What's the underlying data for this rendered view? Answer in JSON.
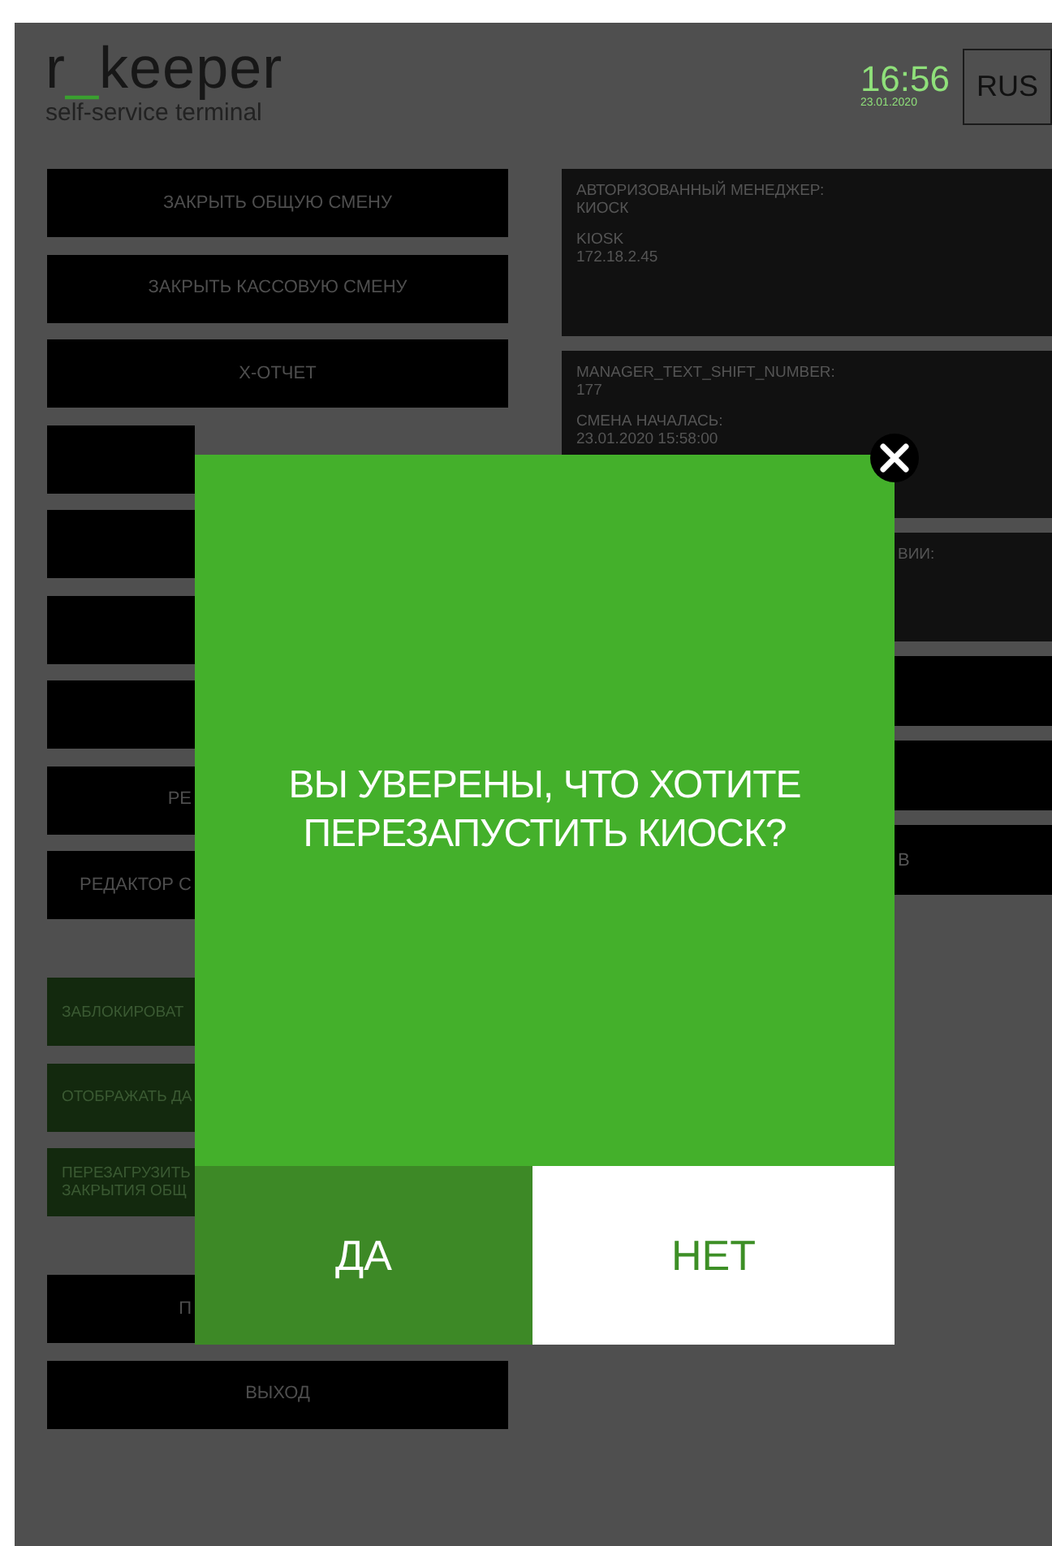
{
  "header": {
    "logo": {
      "before": "r",
      "mark": "_",
      "after": "keeper"
    },
    "subtitle": "self-service terminal",
    "time": "16:56",
    "date": "23.01.2020",
    "language": "RUS"
  },
  "left_groups": [
    [
      {
        "kind": "action",
        "label": "ЗАКРЫТЬ ОБЩУЮ СМЕНУ",
        "covered": false
      },
      {
        "kind": "action",
        "label": "ЗАКРЫТЬ КАССОВУЮ СМЕНУ",
        "covered": false
      },
      {
        "kind": "action",
        "label": "X-ОТЧЕТ",
        "covered": false
      },
      {
        "kind": "action",
        "covered": true
      },
      {
        "kind": "action",
        "covered": true
      },
      {
        "kind": "action",
        "covered": true
      },
      {
        "kind": "action",
        "covered": true
      },
      {
        "kind": "action",
        "label": "РЕ",
        "covered": true
      },
      {
        "kind": "action",
        "label": "РЕДАКТОР С",
        "covered": true
      }
    ],
    [
      {
        "kind": "toggle",
        "label": "ЗАБЛОКИРОВАТ",
        "covered": true
      },
      {
        "kind": "toggle",
        "label": "ОТОБРАЖАТЬ ДА",
        "covered": true
      },
      {
        "kind": "toggle",
        "label": "ПЕРЕЗАГРУЗИТЬ\nЗАКРЫТИЯ ОБЩ",
        "covered": true
      }
    ],
    [
      {
        "kind": "action",
        "label": "П",
        "covered": true
      },
      {
        "kind": "action",
        "label": "ВЫХОД",
        "covered": false
      }
    ]
  ],
  "info_panels": [
    {
      "covered": false,
      "groups": [
        [
          "АВТОРИЗОВАННЫЙ МЕНЕДЖЕР:",
          "КИОСК"
        ],
        [
          "KIOSK",
          "172.18.2.45"
        ]
      ]
    },
    {
      "covered": false,
      "groups": [
        [
          "MANAGER_TEXT_SHIFT_NUMBER:",
          "177"
        ],
        [
          "СМЕНА НАЧАЛАСЬ:",
          "23.01.2020 15:58:00"
        ]
      ]
    },
    {
      "covered": true,
      "groups": [
        [
          "ВИИ:"
        ]
      ]
    }
  ],
  "right_buttons": [
    {
      "covered": true
    },
    {
      "covered": true
    },
    {
      "label": "В",
      "covered": true
    }
  ],
  "dialog": {
    "message": "ВЫ УВЕРЕНЫ, ЧТО ХОТИТЕ ПЕРЕЗАПУСТИТЬ КИОСК?",
    "buttons": [
      {
        "kind": "confirm",
        "label": "ДА"
      },
      {
        "kind": "cancel",
        "label": "НЕТ"
      }
    ]
  }
}
